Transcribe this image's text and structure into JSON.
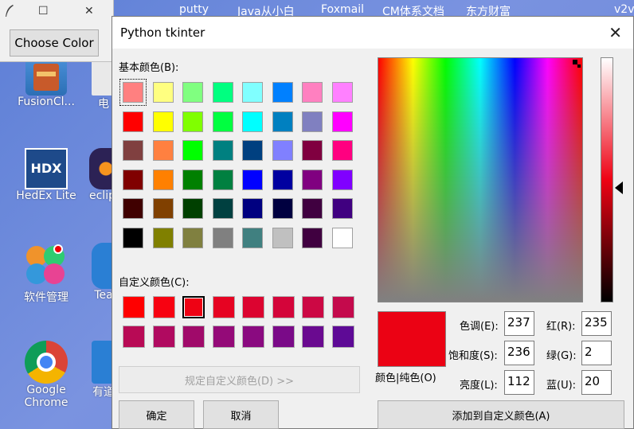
{
  "desktop": {
    "top_links": [
      "putty",
      "Java从小白",
      "Foxmail",
      "CM体系文档",
      "东方财富",
      "v2v"
    ],
    "icons": [
      {
        "label": "FusionCl..."
      },
      {
        "label": "电"
      },
      {
        "label": "HedEx Lite"
      },
      {
        "label": "eclip"
      },
      {
        "label": "软件管理"
      },
      {
        "label": "Tea"
      },
      {
        "label": "Google\nChrome"
      },
      {
        "label": "有道"
      }
    ]
  },
  "tk_main": {
    "minimize": "☐",
    "close": "✕",
    "choose_color_label": "Choose Color"
  },
  "dialog": {
    "title": "Python tkinter",
    "close": "✕",
    "basic_colors_label": "基本颜色(B):",
    "basic_colors": [
      [
        "#ff8080",
        "#ffff80",
        "#80ff80",
        "#00ff80",
        "#80ffff",
        "#0080ff",
        "#ff80c0",
        "#ff80ff"
      ],
      [
        "#ff0000",
        "#ffff00",
        "#80ff00",
        "#00ff40",
        "#00ffff",
        "#0080c0",
        "#8080c0",
        "#ff00ff"
      ],
      [
        "#804040",
        "#ff8040",
        "#00ff00",
        "#008080",
        "#004080",
        "#8080ff",
        "#800040",
        "#ff0080"
      ],
      [
        "#800000",
        "#ff8000",
        "#008000",
        "#008040",
        "#0000ff",
        "#0000a0",
        "#800080",
        "#8000ff"
      ],
      [
        "#400000",
        "#804000",
        "#004000",
        "#004040",
        "#000080",
        "#000040",
        "#400040",
        "#400080"
      ],
      [
        "#000000",
        "#808000",
        "#808040",
        "#808080",
        "#408080",
        "#c0c0c0",
        "#400040",
        "#ffffff"
      ]
    ],
    "custom_colors_label": "自定义颜色(C):",
    "custom_colors": [
      [
        "#ff0000",
        "#f70211",
        "#ee0214",
        "#e60322",
        "#dc0430",
        "#d4053a",
        "#cc0844",
        "#c40a4c"
      ],
      [
        "#b80a55",
        "#b00a60",
        "#a00a6a",
        "#940a78",
        "#8a0a80",
        "#7a0a88",
        "#6a0a90",
        "#5e0a96"
      ]
    ],
    "define_custom_label": "规定自定义颜色(D) >>",
    "ok_label": "确定",
    "cancel_label": "取消",
    "preview_label": "颜色|纯色(O)",
    "hue_label": "色调(E):",
    "hue_value": "237",
    "sat_label": "饱和度(S):",
    "sat_value": "236",
    "lum_label": "亮度(L):",
    "lum_value": "112",
    "red_label": "红(R):",
    "red_value": "235",
    "green_label": "绿(G):",
    "green_value": "2",
    "blue_label": "蓝(U):",
    "blue_value": "20",
    "add_custom_label": "添加到自定义颜色(A)",
    "preview_color": "#eb0214"
  }
}
